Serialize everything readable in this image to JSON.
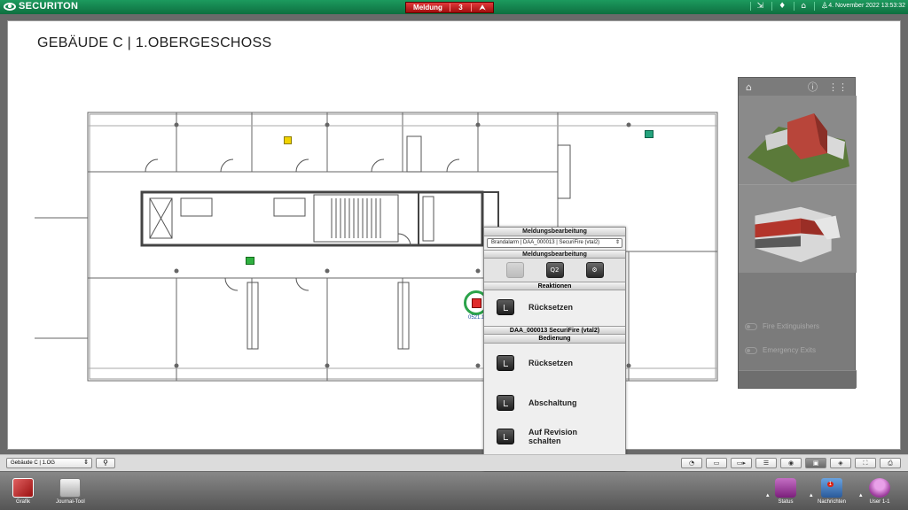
{
  "topbar": {
    "brand": "SECURITON",
    "alarm": {
      "label": "Meldung",
      "count": "3",
      "arrow": "⮝"
    },
    "icons": [
      "⇲",
      "♦",
      "⌂",
      "♙"
    ],
    "datetime": "4. November 2022 13:53:32"
  },
  "main": {
    "title": "GEBÄUDE  C  |  1.OBERGESCHOSS",
    "detector_label": "0521.1"
  },
  "side_panel": {
    "toggles": [
      {
        "label": "Fire Extinguishers"
      },
      {
        "label": "Emergency Exits"
      }
    ]
  },
  "popup": {
    "header1": "Meldungsbearbeitung",
    "select_value": "Brandalarm | DAA_000013 | SecuriFire (vtal2)",
    "header2": "Meldungsbearbeitung",
    "icon_btn_2": "Q2",
    "icon_btn_3": "⚙",
    "header3": "Reaktionen",
    "reset1": "Rücksetzen",
    "device_header": "DAA_000013 SecuriFire (vtal2)",
    "header4": "Bedienung",
    "reset2": "Rücksetzen",
    "shutdown": "Abschaltung",
    "revision": "Auf Revision schalten"
  },
  "toolbar": {
    "select_value": "Gebäude C | 1.OG",
    "search_icon": "⚲",
    "buttons": [
      "◔",
      "▭",
      "▭▸",
      "☰",
      "◉",
      "▣",
      "◈",
      "⛶",
      "⎙"
    ]
  },
  "taskbar": {
    "grafik": "Grafik",
    "journal": "Journal-Tool",
    "status": "Status",
    "nachrichten": "Nachrichten",
    "nachrichten_badge": "1",
    "user": "User 1-1"
  },
  "colors": {
    "topbar_green": "#0e6f3f",
    "alarm_red": "#c11a1a",
    "detector_red": "#e02b2b",
    "detector_ring": "#2ba34a"
  }
}
